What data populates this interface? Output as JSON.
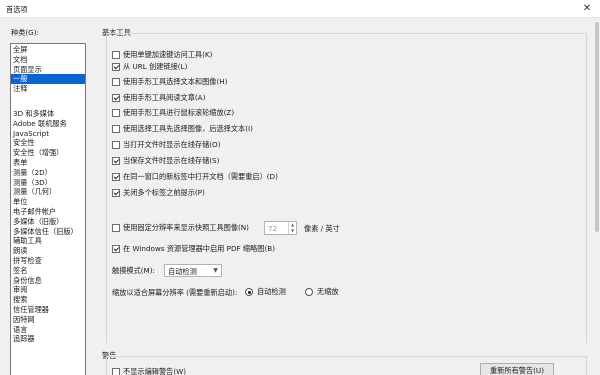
{
  "window": {
    "title": "首选项"
  },
  "categories": {
    "label": "种类(G):",
    "top": [
      "全屏",
      "文档",
      "页面显示",
      "一般",
      "注释"
    ],
    "selected": "一般",
    "rest": [
      "3D 和多媒体",
      "Adobe 联机服务",
      "JavaScript",
      "安全性",
      "安全性（增强）",
      "表单",
      "测量（2D）",
      "测量（3D）",
      "测量（几何）",
      "单位",
      "电子邮件帐户",
      "多媒体（旧版）",
      "多媒体信任（旧版）",
      "辅助工具",
      "朗读",
      "拼写检查",
      "签名",
      "身份信息",
      "审阅",
      "搜索",
      "信任管理器",
      "因特网",
      "语言",
      "追踪器"
    ]
  },
  "basic_tools": {
    "title": "基本工具",
    "options": [
      {
        "label": "使用单键加速键访问工具(K)",
        "checked": false
      },
      {
        "label": "从 URL 创建链接(L)",
        "checked": true
      },
      {
        "label": "使用手形工具选择文本和图像(H)",
        "checked": false
      },
      {
        "label": "使用手形工具阅读文章(A)",
        "checked": true
      },
      {
        "label": "使用手形工具进行鼠标滚轮缩放(Z)",
        "checked": false
      },
      {
        "label": "使用选择工具先选择图像，后选择文本(I)",
        "checked": false
      },
      {
        "label": "当打开文件时显示在线存储(O)",
        "checked": false
      },
      {
        "label": "当保存文件时显示在线存储(S)",
        "checked": true
      },
      {
        "label": "在同一窗口的新标签中打开文档（需要重启）(D)",
        "checked": true
      },
      {
        "label": "关闭多个标签之前提示(P)",
        "checked": true
      }
    ],
    "fixed_resolution": {
      "label": "使用固定分辨率来显示快照工具图像(N)",
      "checked": false,
      "value": "72",
      "unit": "像素 / 英寸"
    },
    "thumbnail": {
      "label": "在 Windows 资源管理器中启用 PDF 缩略图(B)",
      "checked": true
    },
    "touch_mode": {
      "label": "触摸模式(M):",
      "value": "自动检测"
    },
    "scaling": {
      "label": "缩放以适合屏幕分辨率 (需要重新启动):",
      "auto": "自动检测",
      "auto_selected": true,
      "none": "无缩放"
    }
  },
  "warnings": {
    "title": "警告",
    "no_edit_warning": {
      "label": "不显示编辑警告(W)",
      "checked": false
    },
    "reset_button": "重新所有警告(U)"
  }
}
